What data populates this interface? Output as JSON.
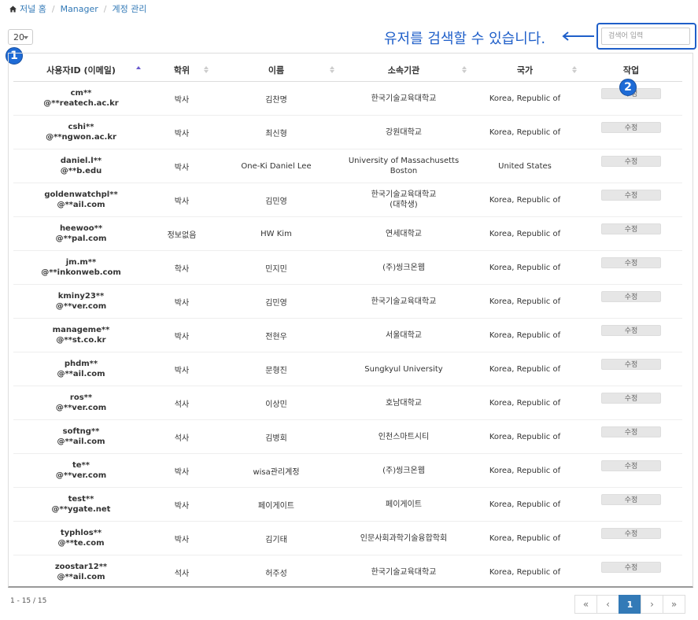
{
  "breadcrumb": {
    "home": "저널 홈",
    "item_2": "Manager",
    "item_3": "계정 관리"
  },
  "page_size": {
    "value": "20"
  },
  "annotation": {
    "hint": "유저를 검색할 수 있습니다.",
    "badge_1": "1",
    "badge_2": "2"
  },
  "search": {
    "placeholder": "검색어 입력"
  },
  "table": {
    "headers": {
      "user_id": "사용자ID (이메일)",
      "degree": "학위",
      "name": "이름",
      "affiliation": "소속기관",
      "country": "국가",
      "action": "작업"
    },
    "edit_label": "수정",
    "rows": [
      {
        "id1": "cm**",
        "id2": "@**reatech.ac.kr",
        "degree": "박사",
        "name": "김찬명",
        "aff1": "한국기술교육대학교",
        "aff2": "",
        "country": "Korea, Republic of"
      },
      {
        "id1": "cshi**",
        "id2": "@**ngwon.ac.kr",
        "degree": "박사",
        "name": "최신형",
        "aff1": "강원대학교",
        "aff2": "",
        "country": "Korea, Republic of"
      },
      {
        "id1": "daniel.l**",
        "id2": "@**b.edu",
        "degree": "박사",
        "name": "One-Ki Daniel Lee",
        "aff1": "University of Massachusetts Boston",
        "aff2": "",
        "country": "United States"
      },
      {
        "id1": "goldenwatchpl**",
        "id2": "@**ail.com",
        "degree": "박사",
        "name": "김민영",
        "aff1": "한국기술교육대학교",
        "aff2": "(대학생)",
        "country": "Korea, Republic of"
      },
      {
        "id1": "heewoo**",
        "id2": "@**pal.com",
        "degree": "정보없음",
        "name": "HW Kim",
        "aff1": "연세대학교",
        "aff2": "",
        "country": "Korea, Republic of"
      },
      {
        "id1": "jm.m**",
        "id2": "@**inkonweb.com",
        "degree": "학사",
        "name": "민지민",
        "aff1": "(주)씽크온웹",
        "aff2": "",
        "country": "Korea, Republic of"
      },
      {
        "id1": "kminy23**",
        "id2": "@**ver.com",
        "degree": "박사",
        "name": "김민영",
        "aff1": "한국기술교육대학교",
        "aff2": "",
        "country": "Korea, Republic of"
      },
      {
        "id1": "manageme**",
        "id2": "@**st.co.kr",
        "degree": "박사",
        "name": "전현우",
        "aff1": "서울대학교",
        "aff2": "",
        "country": "Korea, Republic of"
      },
      {
        "id1": "phdm**",
        "id2": "@**ail.com",
        "degree": "박사",
        "name": "문형진",
        "aff1": "Sungkyul University",
        "aff2": "",
        "country": "Korea, Republic of"
      },
      {
        "id1": "ros**",
        "id2": "@**ver.com",
        "degree": "석사",
        "name": "이상민",
        "aff1": "호남대학교",
        "aff2": "",
        "country": "Korea, Republic of"
      },
      {
        "id1": "softng**",
        "id2": "@**ail.com",
        "degree": "석사",
        "name": "김병회",
        "aff1": "인천스마트시티",
        "aff2": "",
        "country": "Korea, Republic of"
      },
      {
        "id1": "te**",
        "id2": "@**ver.com",
        "degree": "박사",
        "name": "wisa관리계정",
        "aff1": "(주)씽크온웹",
        "aff2": "",
        "country": "Korea, Republic of"
      },
      {
        "id1": "test**",
        "id2": "@**ygate.net",
        "degree": "박사",
        "name": "페이게이트",
        "aff1": "페이게이트",
        "aff2": "",
        "country": "Korea, Republic of"
      },
      {
        "id1": "typhlos**",
        "id2": "@**te.com",
        "degree": "박사",
        "name": "김기태",
        "aff1": "인문사회과학기술융합학회",
        "aff2": "",
        "country": "Korea, Republic of"
      },
      {
        "id1": "zoostar12**",
        "id2": "@**ail.com",
        "degree": "석사",
        "name": "허주성",
        "aff1": "한국기술교육대학교",
        "aff2": "",
        "country": "Korea, Republic of"
      }
    ]
  },
  "pagination": {
    "info": "1 - 15 / 15",
    "first": "«",
    "prev": "‹",
    "current": "1",
    "next": "›",
    "last": "»"
  }
}
